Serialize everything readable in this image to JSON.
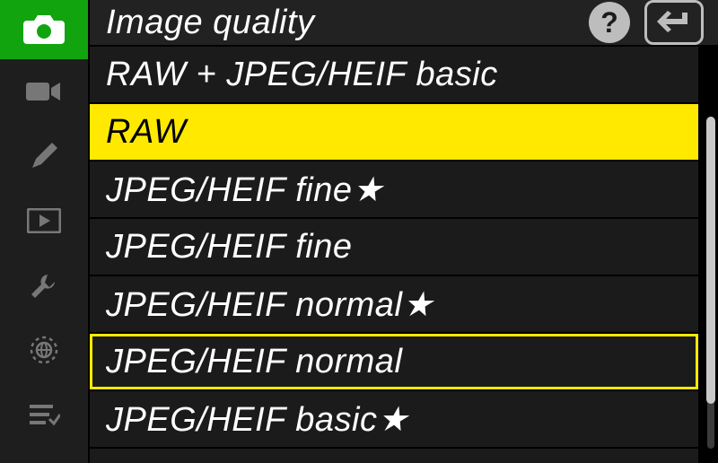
{
  "header": {
    "title": "Image quality",
    "help_label": "?",
    "back_label": "Back"
  },
  "sidebar": {
    "tabs": [
      {
        "id": "photo",
        "icon": "camera-icon",
        "active": true
      },
      {
        "id": "video",
        "icon": "video-icon",
        "active": false
      },
      {
        "id": "custom",
        "icon": "pencil-icon",
        "active": false
      },
      {
        "id": "play",
        "icon": "playback-icon",
        "active": false
      },
      {
        "id": "setup",
        "icon": "wrench-icon",
        "active": false
      },
      {
        "id": "network",
        "icon": "network-icon",
        "active": false
      },
      {
        "id": "mymenu",
        "icon": "mymenu-icon",
        "active": false
      }
    ]
  },
  "list": {
    "items": [
      {
        "label": "RAW + JPEG/HEIF basic",
        "selected": false,
        "current": false
      },
      {
        "label": "RAW",
        "selected": true,
        "current": false
      },
      {
        "label": "JPEG/HEIF fine★",
        "selected": false,
        "current": false
      },
      {
        "label": "JPEG/HEIF fine",
        "selected": false,
        "current": false
      },
      {
        "label": "JPEG/HEIF normal★",
        "selected": false,
        "current": false
      },
      {
        "label": "JPEG/HEIF normal",
        "selected": false,
        "current": true
      },
      {
        "label": "JPEG/HEIF basic★",
        "selected": false,
        "current": false
      }
    ],
    "partial_next": ""
  }
}
